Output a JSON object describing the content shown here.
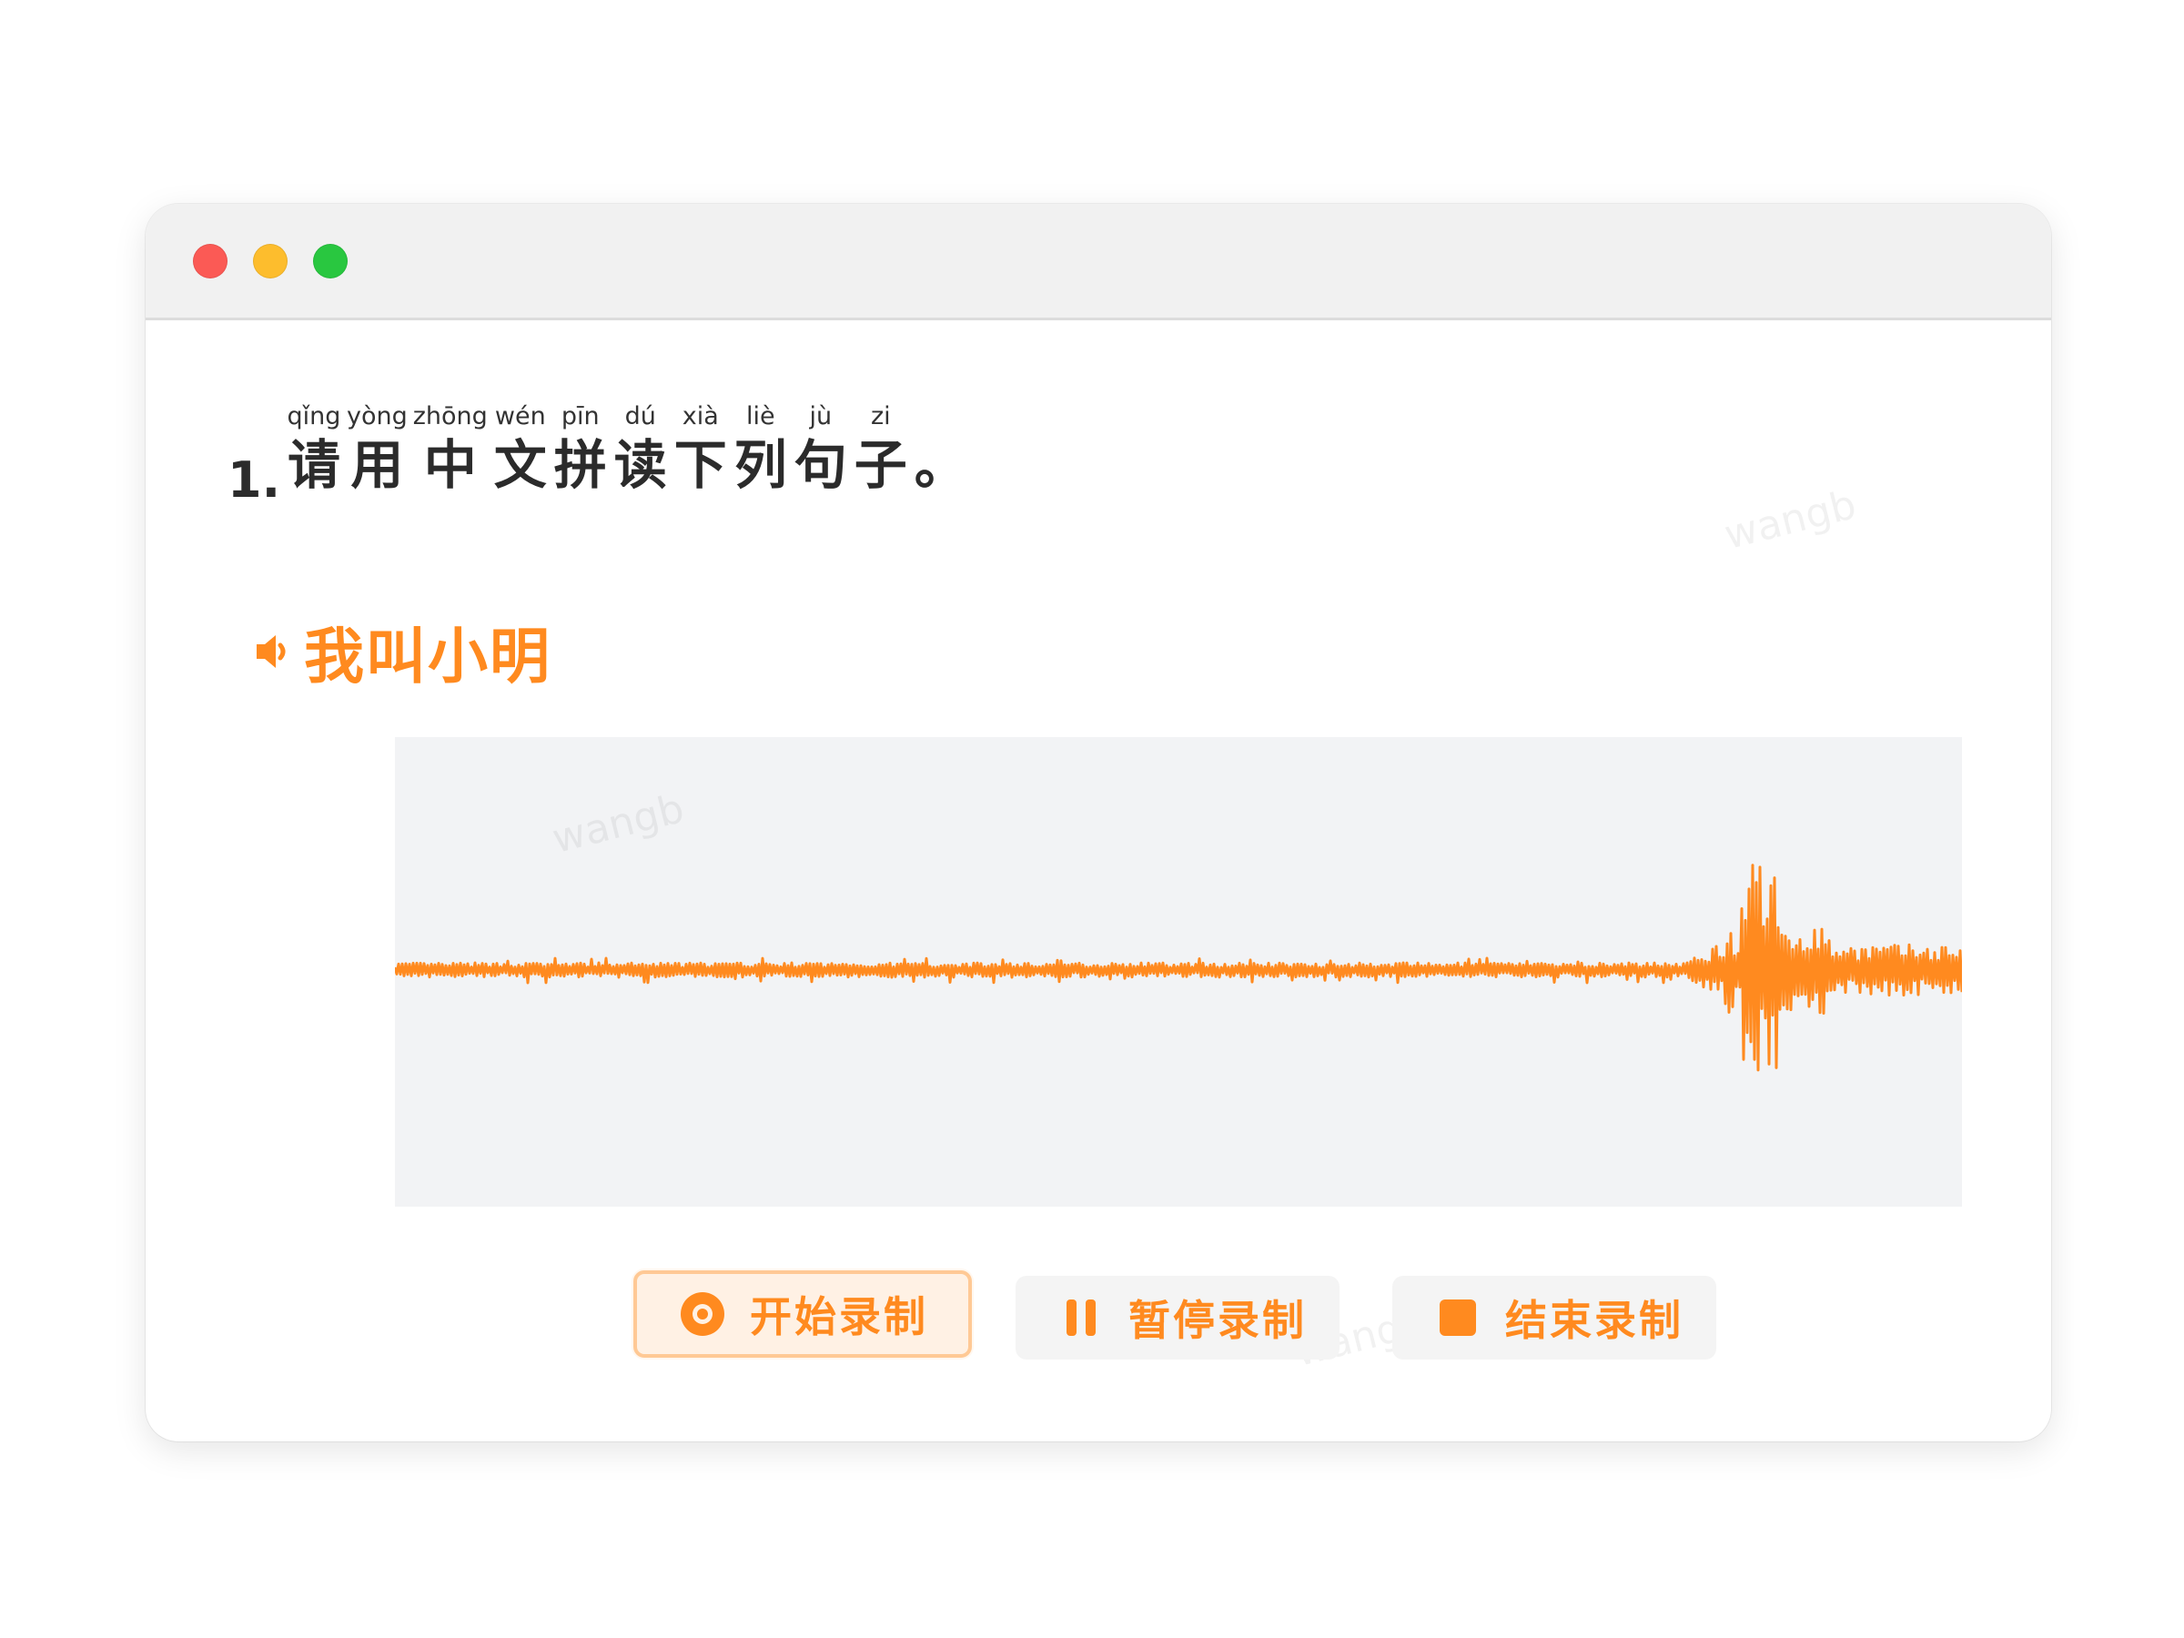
{
  "question": {
    "number": "1.",
    "ruby": [
      {
        "pinyin": "qǐng",
        "hanzi": "请"
      },
      {
        "pinyin": "yòng",
        "hanzi": "用"
      },
      {
        "pinyin": "zhōng",
        "hanzi": "中"
      },
      {
        "pinyin": "wén",
        "hanzi": "文"
      },
      {
        "pinyin": "pīn",
        "hanzi": "拼"
      },
      {
        "pinyin": "dú",
        "hanzi": "读"
      },
      {
        "pinyin": "xià",
        "hanzi": "下"
      },
      {
        "pinyin": "liè",
        "hanzi": "列"
      },
      {
        "pinyin": "jù",
        "hanzi": "句"
      },
      {
        "pinyin": "zi",
        "hanzi": "子"
      },
      {
        "pinyin": "",
        "hanzi": "。"
      }
    ]
  },
  "sentence": {
    "icon": "speaker-icon",
    "text": "我叫小明"
  },
  "waveform": {
    "color": "#ff8a1f",
    "background": "#f2f3f5"
  },
  "controls": {
    "start_label": "开始录制",
    "pause_label": "暂停录制",
    "stop_label": "结束录制",
    "start_icon": "record-icon",
    "pause_icon": "pause-icon",
    "stop_icon": "stop-icon"
  },
  "watermark": "wangb",
  "colors": {
    "accent": "#ff8a1f",
    "traffic_red": "#fb5a55",
    "traffic_yellow": "#fdbd2d",
    "traffic_green": "#29c740"
  }
}
